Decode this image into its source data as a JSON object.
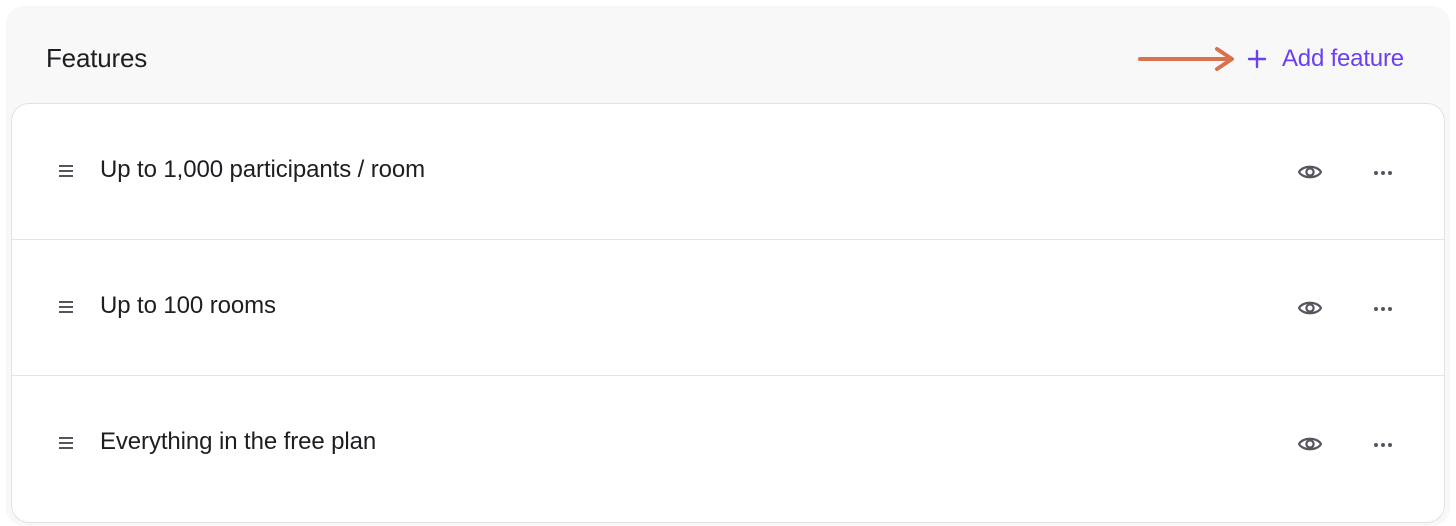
{
  "header": {
    "title": "Features",
    "add_label": "Add feature"
  },
  "features": [
    {
      "label": "Up to 1,000 participants / room"
    },
    {
      "label": "Up to 100 rooms"
    },
    {
      "label": "Everything in the free plan"
    }
  ],
  "icons": {
    "drag": "drag-handle-icon",
    "visibility": "eye-icon",
    "menu": "more-horizontal-icon",
    "add": "plus-icon",
    "annotation": "arrow-right-icon"
  },
  "colors": {
    "accent": "#6b40f2",
    "annotation_arrow": "#d9714f",
    "text": "#1d1d22",
    "icon": "#55555e",
    "panel_bg": "#f8f8f8"
  }
}
